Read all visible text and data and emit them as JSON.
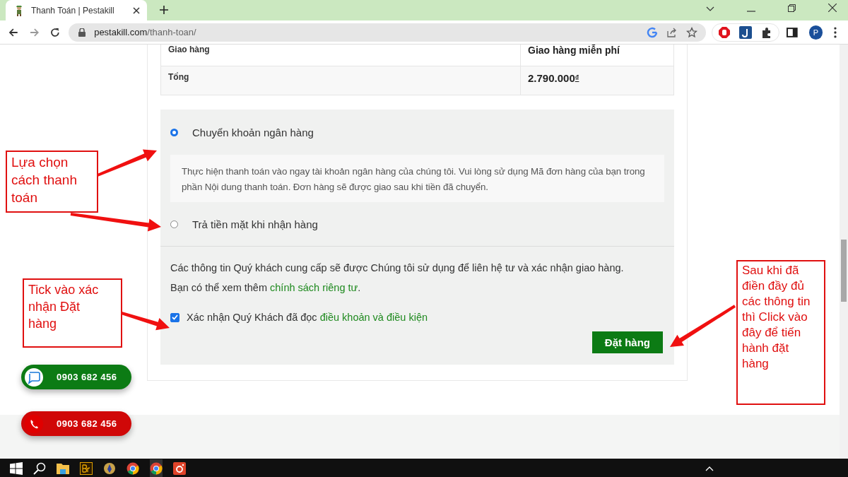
{
  "browser": {
    "tab_title": "Thanh Toán | Pestakill",
    "url_host": "pestakill.com",
    "url_path": "/thanh-toan/",
    "profile_initial": "P"
  },
  "totals": [
    {
      "label": "Giao hàng",
      "value": "Giao hàng miễn phí"
    },
    {
      "label": "Tổng",
      "value": "2.790.000",
      "currency": "₫"
    }
  ],
  "payment_methods": [
    {
      "label": "Chuyển khoản ngân hàng",
      "selected": true,
      "description": "Thực hiện thanh toán vào ngay tài khoản ngân hàng của chúng tôi. Vui lòng sử dụng Mã đơn hàng của bạn trong phần Nội dung thanh toán. Đơn hàng sẽ được giao sau khi tiền đã chuyển."
    },
    {
      "label": "Trả tiền mặt khi nhận hàng",
      "selected": false
    }
  ],
  "privacy_notice": {
    "text": "Các thông tin Quý khách cung cấp sẽ được Chúng tôi sử dụng để liên hệ tư và xác nhận giao hàng. Bạn có thể xem thêm ",
    "link": "chính sách riêng tư",
    "end": "."
  },
  "terms": {
    "checked": true,
    "text": "Xác nhận Quý Khách đã đọc ",
    "link": "điều khoản và điều kiện"
  },
  "place_order_button": "Đặt hàng",
  "contact_buttons": [
    {
      "kind": "zalo",
      "phone": "0903 682 456"
    },
    {
      "kind": "call",
      "phone": "0903 682 456"
    }
  ],
  "annotations": [
    {
      "text": "Lựa chọn cách thanh toán"
    },
    {
      "text": "Tick vào xác nhận Đặt hàng"
    },
    {
      "text": "Sau khi đã điền đầy đủ các thông tin thì Click vào đây để tiến hành đặt hàng"
    }
  ]
}
